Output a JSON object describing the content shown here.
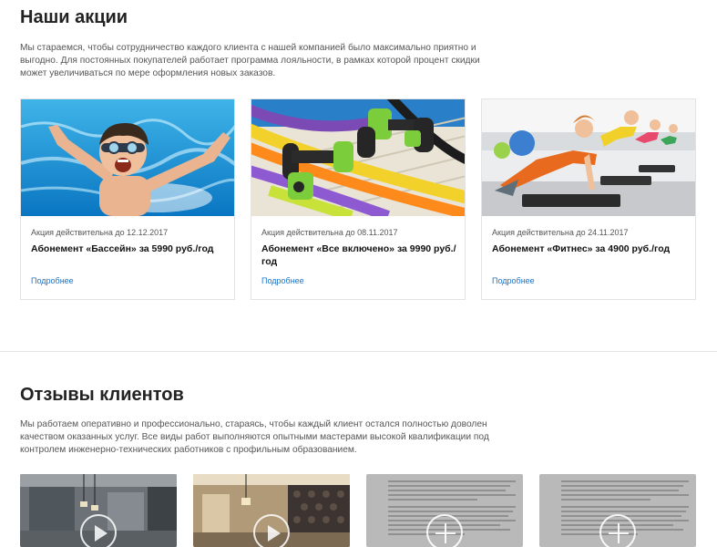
{
  "promotions": {
    "title": "Наши акции",
    "description": "Мы стараемся, чтобы сотрудничество каждого клиента с нашей компанией было максимально приятно и выгодно. Для постоянных покупателей работает программа лояльности, в рамках которой процент скидки может увеличиваться по мере оформления новых заказов.",
    "cards": [
      {
        "valid": "Акция действительна до 12.12.2017",
        "name": "Абонемент «Бассейн» за 5990 руб./год",
        "more": "Подробнее",
        "image": "swimming-child-photo"
      },
      {
        "valid": "Акция действительна до 08.11.2017",
        "name": "Абонемент «Все включено» за 9990 руб./год",
        "more": "Подробнее",
        "image": "aqua-dumbbells-noodles-photo"
      },
      {
        "valid": "Акция действительна до 24.11.2017",
        "name": "Абонемент «Фитнес» за 4900 руб./год",
        "more": "Подробнее",
        "image": "kids-fitness-pushups-photo"
      }
    ]
  },
  "reviews": {
    "title": "Отзывы клиентов",
    "description": "Мы работаем оперативно и профессионально, стараясь, чтобы каждый клиент остался полностью доволен качеством оказанных услуг. Все виды работ выполняются опытными мастерами высокой квалификации под контролем инженерно-технических работников с профильным образованием.",
    "items": [
      {
        "type": "video",
        "image": "modern-interior-photo",
        "icon": "play-icon"
      },
      {
        "type": "video",
        "image": "bedroom-interior-photo",
        "icon": "play-icon"
      },
      {
        "type": "document",
        "image": "review-letter-scan",
        "icon": "plus-icon"
      },
      {
        "type": "document",
        "image": "review-letter-scan",
        "icon": "plus-icon"
      }
    ]
  },
  "colors": {
    "link": "#1a73c9",
    "border": "#e3e3e3",
    "text": "#222222",
    "muted": "#555555",
    "doc_bg": "#b9b9b9"
  }
}
